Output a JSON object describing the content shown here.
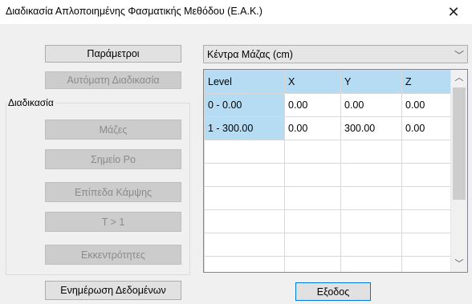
{
  "window": {
    "title": "Διαδικασία Απλοποιημένης Φασματικής Μεθόδου (Ε.Α.Κ.)",
    "close_glyph": "✕",
    "close_icon": "close-icon"
  },
  "left_panel": {
    "parameters_button": "Παράμετροι",
    "auto_procedure_button": "Αυτόματη Διαδικασία",
    "group_label": "Διαδικασία",
    "masses_button": "Μάζες",
    "point_po_button": "Σημείο Ρο",
    "bending_levels_button": "Επίπεδα Κάμψης",
    "t_gt_1_button": "T > 1",
    "eccentricities_button": "Εκκεντρότητες",
    "update_data_button": "Ενημέρωση Δεδομένων"
  },
  "combo": {
    "selected": "Κέντρα Μάζας (cm)",
    "arrow_icon": "chevron-down-icon",
    "arrow_glyph": "﹀"
  },
  "grid": {
    "columns": [
      "Level",
      "X",
      "Y",
      "Z"
    ],
    "rows": [
      [
        "0 - 0.00",
        "0.00",
        "0.00",
        "0.00"
      ],
      [
        "1 - 300.00",
        "0.00",
        "300.00",
        "0.00"
      ]
    ],
    "scroll_up_glyph": "︿",
    "scroll_down_glyph": "﹀"
  },
  "footer": {
    "exit_button": "Εξοδος"
  },
  "colors": {
    "header_bg": "#b6dcf4",
    "focus_border": "#0078d7"
  }
}
